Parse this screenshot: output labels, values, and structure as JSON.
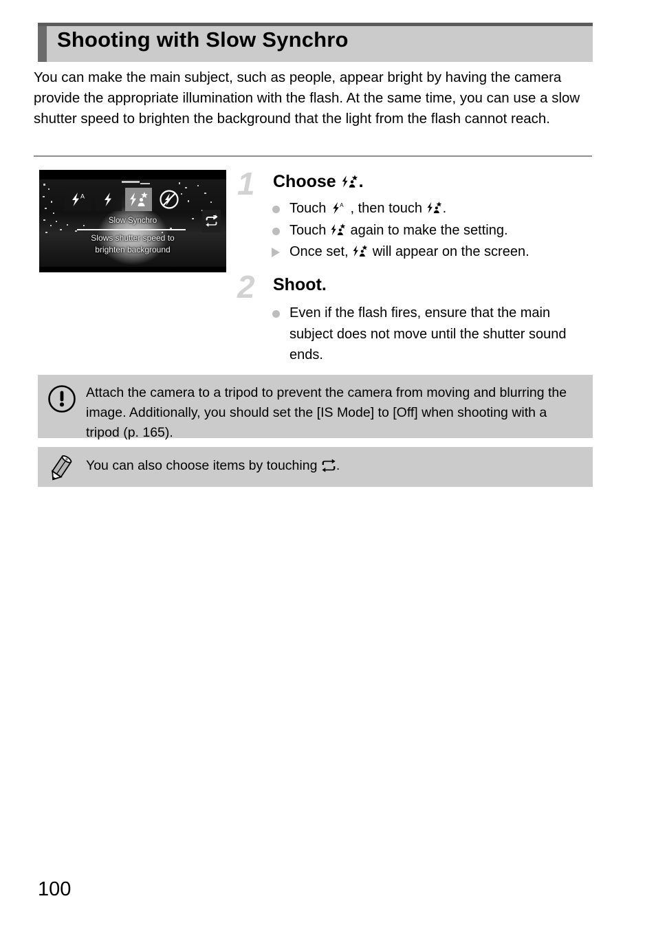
{
  "page": {
    "title": "Shooting with Slow Synchro",
    "number": "100",
    "intro": "You can make the main subject, such as people, appear bright by having the camera provide the appropriate illumination with the flash. At the same time, you can use a slow shutter speed to brighten the background that the light from the flash cannot reach."
  },
  "camera_screen": {
    "flash_modes": [
      {
        "name": "flash-auto",
        "label": "Auto flash",
        "selected": false
      },
      {
        "name": "flash-on",
        "label": "Flash on",
        "selected": false
      },
      {
        "name": "flash-slow-synchro",
        "label": "Slow Synchro",
        "selected": true
      },
      {
        "name": "flash-off",
        "label": "Flash off",
        "selected": false
      }
    ],
    "selected_label": "Slow Synchro",
    "description_line1": "Slows shutter speed to",
    "description_line2": "brighten background",
    "switch_icon": "loop-switch-icon"
  },
  "steps": [
    {
      "number": "1",
      "heading_prefix": "Choose",
      "heading_suffix": ".",
      "heading_icon": "flash-slow-synchro-icon",
      "items": [
        {
          "bullet": "dot",
          "parts": [
            "Touch ",
            "flash-auto-icon",
            " , then touch ",
            "flash-slow-synchro-icon",
            "."
          ]
        },
        {
          "bullet": "dot",
          "parts": [
            "Touch ",
            "flash-slow-synchro-icon",
            " again to make the setting."
          ]
        },
        {
          "bullet": "triangle",
          "parts": [
            "Once set, ",
            "flash-slow-synchro-icon",
            " will appear on the screen."
          ]
        }
      ]
    },
    {
      "number": "2",
      "heading_prefix": "Shoot.",
      "heading_suffix": "",
      "heading_icon": "",
      "items": [
        {
          "bullet": "dot",
          "parts": [
            "Even if the flash fires, ensure that the main subject does not move until the shutter sound ends."
          ]
        }
      ]
    }
  ],
  "caution_box": {
    "icon": "exclamation-circle-icon",
    "text": "Attach the camera to a tripod to prevent the camera from moving and blurring the image. Additionally, you should set the [IS Mode] to [Off] when shooting with a tripod (p. 165)."
  },
  "note_box": {
    "icon": "pencil-icon",
    "text_before": "You can also choose items by touching ",
    "icon_inline": "loop-switch-icon",
    "text_after": "."
  },
  "colors": {
    "header_band": "#cbcbcb",
    "header_topline": "#5c5c5c",
    "header_leftbar": "#6b6b6b",
    "step_number": "#d2d2d2",
    "bullet": "#bdbdbd",
    "box_bg": "#cbcbcb",
    "rule": "#8f8f8f"
  }
}
